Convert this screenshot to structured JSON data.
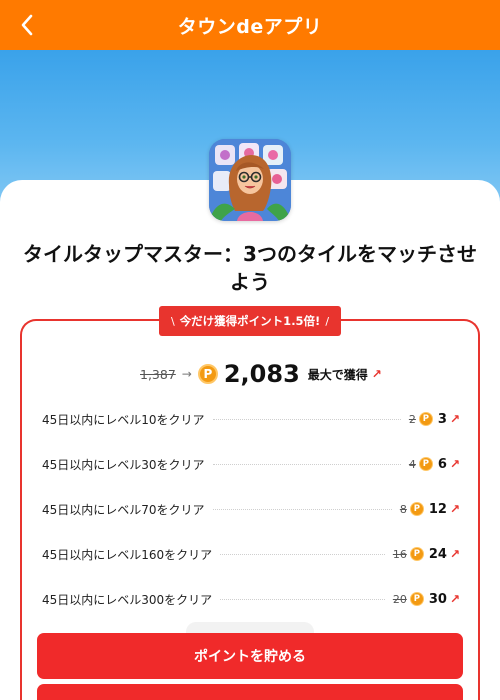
{
  "header": {
    "title": "タウンdeアプリ",
    "back_icon": "chevron-left-icon",
    "background_color": "#ff7a00"
  },
  "app": {
    "title": "タイルタップマスター：3つのタイルをマッチさせよう",
    "icon": "app-icon-tile-game-girl"
  },
  "promo": {
    "tag": "今だけ獲得ポイント1.5倍!",
    "accent_color": "#e8342e"
  },
  "summary": {
    "old_total": "1,387",
    "arrow": "→",
    "coin_symbol": "P",
    "new_total": "2,083",
    "max_label": "最大で獲得"
  },
  "tasks": [
    {
      "label": "45日以内にレベル10をクリア",
      "old": "2",
      "new": "3"
    },
    {
      "label": "45日以内にレベル30をクリア",
      "old": "4",
      "new": "6"
    },
    {
      "label": "45日以内にレベル70をクリア",
      "old": "8",
      "new": "12"
    },
    {
      "label": "45日以内にレベル160をクリア",
      "old": "16",
      "new": "24"
    },
    {
      "label": "45日以内にレベル300をクリア",
      "old": "20",
      "new": "30"
    }
  ],
  "buttons": {
    "primary": "ポイントを貯める",
    "primary_color": "#f02a2a"
  }
}
